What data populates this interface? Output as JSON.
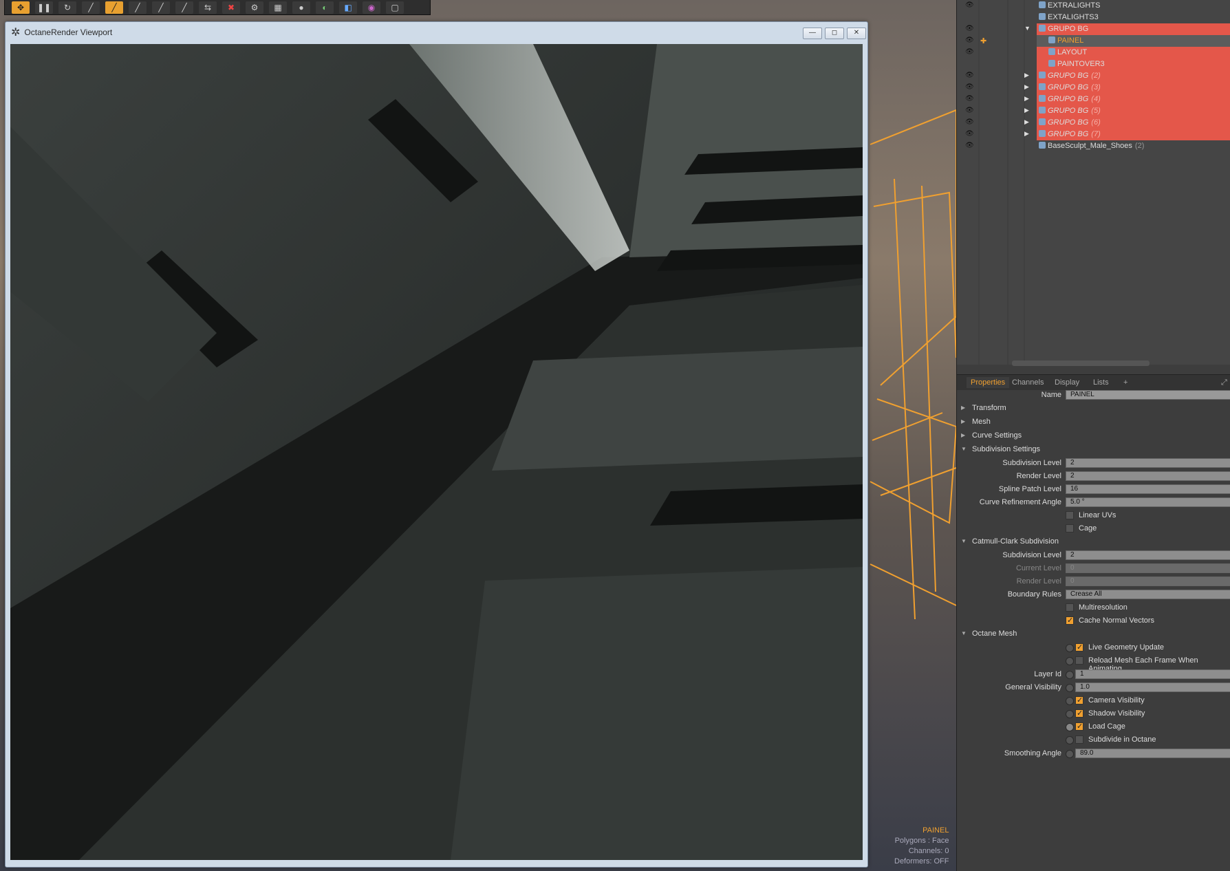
{
  "viewport": {
    "title": "OctaneRender Viewport",
    "logo_icon": "octane-logo-icon",
    "minimize_label": "—",
    "maximize_label": "◻",
    "close_label": "✕"
  },
  "outliner": {
    "items": [
      {
        "label": "EXTRALIGHTS",
        "count": ""
      },
      {
        "label": "EXTALIGHTS3",
        "count": ""
      },
      {
        "label": "GRUPO BG",
        "count": ""
      },
      {
        "label": "PAINEL",
        "count": ""
      },
      {
        "label": "LAYOUT",
        "count": ""
      },
      {
        "label": "PAINTOVER3",
        "count": ""
      },
      {
        "label": "GRUPO BG",
        "count": "(2)"
      },
      {
        "label": "GRUPO BG",
        "count": "(3)"
      },
      {
        "label": "GRUPO BG",
        "count": "(4)"
      },
      {
        "label": "GRUPO BG",
        "count": "(5)"
      },
      {
        "label": "GRUPO BG",
        "count": "(6)"
      },
      {
        "label": "GRUPO BG",
        "count": "(7)"
      },
      {
        "label": "BaseSculpt_Male_Shoes",
        "count": "(2)"
      }
    ]
  },
  "tabs": {
    "properties": "Properties",
    "channels": "Channels",
    "display": "Display",
    "lists": "Lists",
    "add": "+"
  },
  "properties": {
    "name_label": "Name",
    "name_value": "PAINEL",
    "sections": {
      "transform": "Transform",
      "mesh": "Mesh",
      "curve_settings": "Curve Settings",
      "subdivision_settings": "Subdivision Settings",
      "catmull": "Catmull-Clark Subdivision",
      "octane_mesh": "Octane Mesh"
    },
    "subdivision_level_label": "Subdivision Level",
    "subdivision_level": "2",
    "render_level_label": "Render Level",
    "render_level": "2",
    "spline_patch_label": "Spline Patch Level",
    "spline_patch": "16",
    "curve_refine_label": "Curve Refinement Angle",
    "curve_refine": "5.0 °",
    "linear_uvs": "Linear UVs",
    "cage": "Cage",
    "cc_subdiv_label": "Subdivision Level",
    "cc_subdiv": "2",
    "current_level_label": "Current Level",
    "current_level": "0",
    "cc_render_label": "Render Level",
    "cc_render": "0",
    "boundary_label": "Boundary Rules",
    "boundary": "Crease All",
    "multires": "Multiresolution",
    "cache_normal": "Cache Normal Vectors",
    "live_geo": "Live Geometry Update",
    "reload_mesh": "Reload Mesh Each Frame When Animating",
    "layer_id_label": "Layer Id",
    "layer_id": "1",
    "gen_vis_label": "General Visibility",
    "gen_vis": "1.0",
    "camera_vis": "Camera Visibility",
    "shadow_vis": "Shadow Visibility",
    "load_cage": "Load Cage",
    "subdiv_octane": "Subdivide in Octane",
    "smoothing_label": "Smoothing Angle",
    "smoothing": "89.0"
  },
  "hud": {
    "name": "PAINEL",
    "polygons": "Polygons : Face",
    "channels": "Channels: 0",
    "deformers": "Deformers: OFF"
  },
  "colors": {
    "accent": "#f0a030",
    "highlight": "#e4574a"
  }
}
